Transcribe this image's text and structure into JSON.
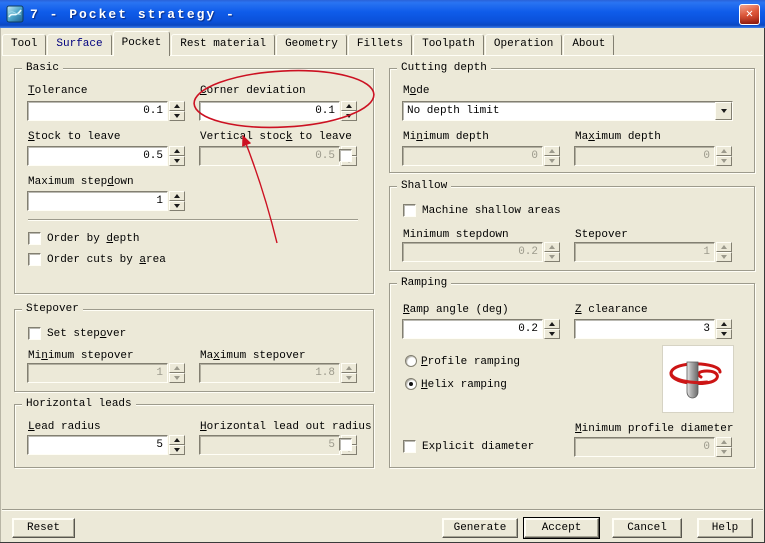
{
  "window": {
    "title": "7 - Pocket strategy -",
    "close_glyph": "✕"
  },
  "tabs": {
    "active": "Pocket",
    "items": [
      {
        "label": "Tool"
      },
      {
        "label": "Surface"
      },
      {
        "label": "Pocket"
      },
      {
        "label": "Rest material"
      },
      {
        "label": "Geometry"
      },
      {
        "label": "Fillets"
      },
      {
        "label": "Toolpath"
      },
      {
        "label": "Operation"
      },
      {
        "label": "About"
      }
    ]
  },
  "basic": {
    "title": "Basic",
    "tolerance": {
      "label": {
        "pre": "",
        "key": "T",
        "post": "olerance"
      },
      "value": "0.1"
    },
    "corner": {
      "label": {
        "pre": "",
        "key": "C",
        "post": "orner deviation"
      },
      "value": "0.1"
    },
    "stock": {
      "label": {
        "pre": "",
        "key": "S",
        "post": "tock to leave"
      },
      "value": "0.5"
    },
    "vstock": {
      "label": {
        "pre": "Vertical stoc",
        "key": "k",
        "post": " to leave"
      },
      "value": "0.5",
      "enabled": false
    },
    "max_stepdown": {
      "label": {
        "pre": "Maximum step",
        "key": "d",
        "post": "own"
      },
      "value": "1"
    },
    "order_by_depth": {
      "label": {
        "pre": "Order by ",
        "key": "d",
        "post": "epth"
      },
      "checked": false
    },
    "order_cuts_by_area": {
      "label": {
        "pre": "Order cuts by ",
        "key": "a",
        "post": "rea"
      },
      "checked": false
    }
  },
  "stepover": {
    "title": "Stepover",
    "set_stepover": {
      "label": {
        "pre": "Set step",
        "key": "o",
        "post": "ver"
      },
      "checked": false
    },
    "min_stepover": {
      "label": {
        "pre": "Mi",
        "key": "n",
        "post": "imum stepover"
      },
      "value": "1",
      "enabled": false
    },
    "max_stepover": {
      "label": {
        "pre": "Ma",
        "key": "x",
        "post": "imum stepover"
      },
      "value": "1.8",
      "enabled": false
    }
  },
  "horizontal_leads": {
    "title": "Horizontal leads",
    "lead_radius": {
      "label": {
        "pre": "",
        "key": "L",
        "post": "ead radius"
      },
      "value": "5"
    },
    "lead_out_radius": {
      "label": {
        "pre": "",
        "key": "H",
        "post": "orizontal lead out radius"
      },
      "value": "5",
      "enabled": false
    }
  },
  "cutting_depth": {
    "title": "Cutting depth",
    "mode": {
      "label": {
        "pre": "M",
        "key": "o",
        "post": "de"
      },
      "value": "No depth limit"
    },
    "min_depth": {
      "label": {
        "pre": "Mi",
        "key": "n",
        "post": "imum depth"
      },
      "value": "0",
      "enabled": false
    },
    "max_depth": {
      "label": {
        "pre": "Ma",
        "key": "x",
        "post": "imum depth"
      },
      "value": "0",
      "enabled": false
    }
  },
  "shallow": {
    "title": "Shallow",
    "machine_shallow": {
      "label": {
        "pre": "Machine shallow areas",
        "key": "",
        "post": ""
      },
      "checked": false
    },
    "min_stepdown": {
      "label": {
        "pre": "Minimum stepdown",
        "key": "",
        "post": ""
      },
      "value": "0.2",
      "enabled": false
    },
    "stepover": {
      "label": {
        "pre": "Stepover",
        "key": "",
        "post": ""
      },
      "value": "1",
      "enabled": false
    }
  },
  "ramping": {
    "title": "Ramping",
    "ramp_angle": {
      "label": {
        "pre": "",
        "key": "R",
        "post": "amp angle (deg)"
      },
      "value": "0.2"
    },
    "z_clearance": {
      "label": {
        "pre": "",
        "key": "Z",
        "post": " clearance"
      },
      "value": "3"
    },
    "profile_ramping": {
      "label": {
        "pre": "",
        "key": "P",
        "post": "rofile ramping"
      },
      "selected": false
    },
    "helix_ramping": {
      "label": {
        "pre": "",
        "key": "H",
        "post": "elix ramping"
      },
      "selected": true
    },
    "explicit_diameter": {
      "label": {
        "pre": "Explicit diameter",
        "key": "",
        "post": ""
      },
      "checked": false
    },
    "min_profile_diameter": {
      "label": {
        "pre": "",
        "key": "M",
        "post": "inimum profile diameter"
      },
      "value": "0",
      "enabled": false
    }
  },
  "buttons": {
    "reset": "Reset",
    "generate": "Generate",
    "accept": "Accept",
    "cancel": "Cancel",
    "help": "Help"
  },
  "annotations": {
    "ellipse_target": "Corner deviation field",
    "arrow_target": "Corner deviation field",
    "color": "#cc1122"
  },
  "colors": {
    "dialog_bg": "#ece9d8",
    "titlebar_blue": "#0f5cea",
    "close_red": "#d0452e",
    "disabled_text": "#9c9a8c",
    "surface_tab_text": "#00007f",
    "annotation_red": "#cc1122"
  }
}
